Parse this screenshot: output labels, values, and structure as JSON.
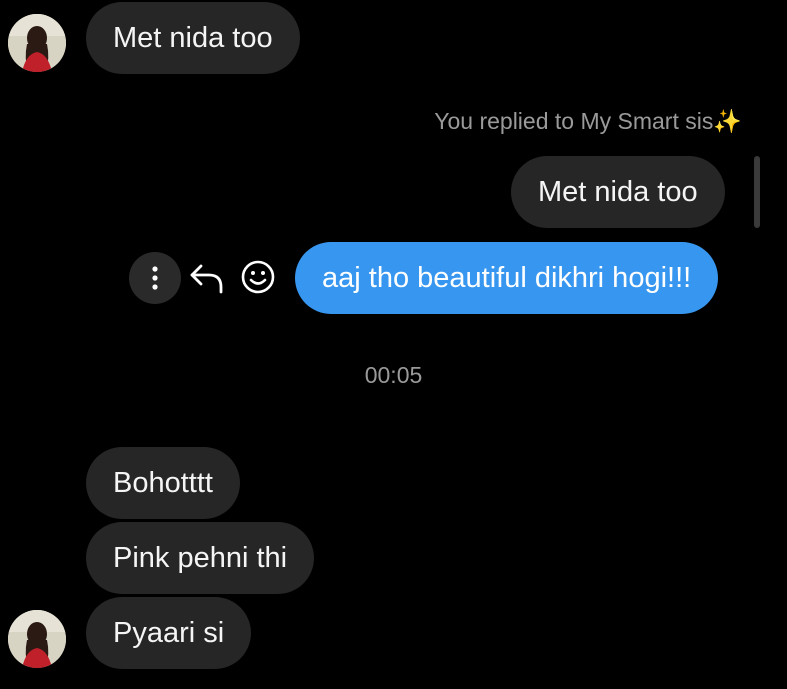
{
  "messages": {
    "received_top": "Met nida too",
    "reply_note": "You replied to My Smart sis",
    "reply_note_emoji": "✨",
    "quoted": "Met nida too",
    "sent": "aaj tho beautiful dikhri hogi!!!",
    "timestamp": "00:05",
    "received_1": "Bohotttt",
    "received_2": "Pink pehni thi",
    "received_3": "Pyaari si"
  },
  "icons": {
    "more": "more-vertical-icon",
    "reply": "reply-arrow-icon",
    "react": "smiley-face-icon"
  },
  "colors": {
    "background": "#000000",
    "received_bubble": "#262626",
    "sent_bubble": "#3797f0",
    "meta_text": "#9a9a9a"
  }
}
